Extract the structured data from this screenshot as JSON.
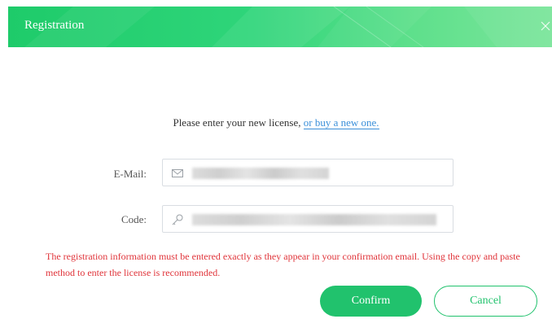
{
  "dialog": {
    "title": "Registration",
    "prompt_text": "Please enter your new license, ",
    "buy_link": "or buy a new one.",
    "email_label": "E-Mail:",
    "code_label": "Code:",
    "warning": "The registration information must be entered exactly as they appear in your confirmation email. Using the copy and paste method to enter the license is recommended.",
    "confirm_label": "Confirm",
    "cancel_label": "Cancel"
  },
  "icons": {
    "close": "close-icon",
    "email": "envelope-icon",
    "code": "key-icon"
  },
  "colors": {
    "accent": "#21c26d",
    "warning": "#e0343a",
    "link": "#3a8fd9"
  }
}
